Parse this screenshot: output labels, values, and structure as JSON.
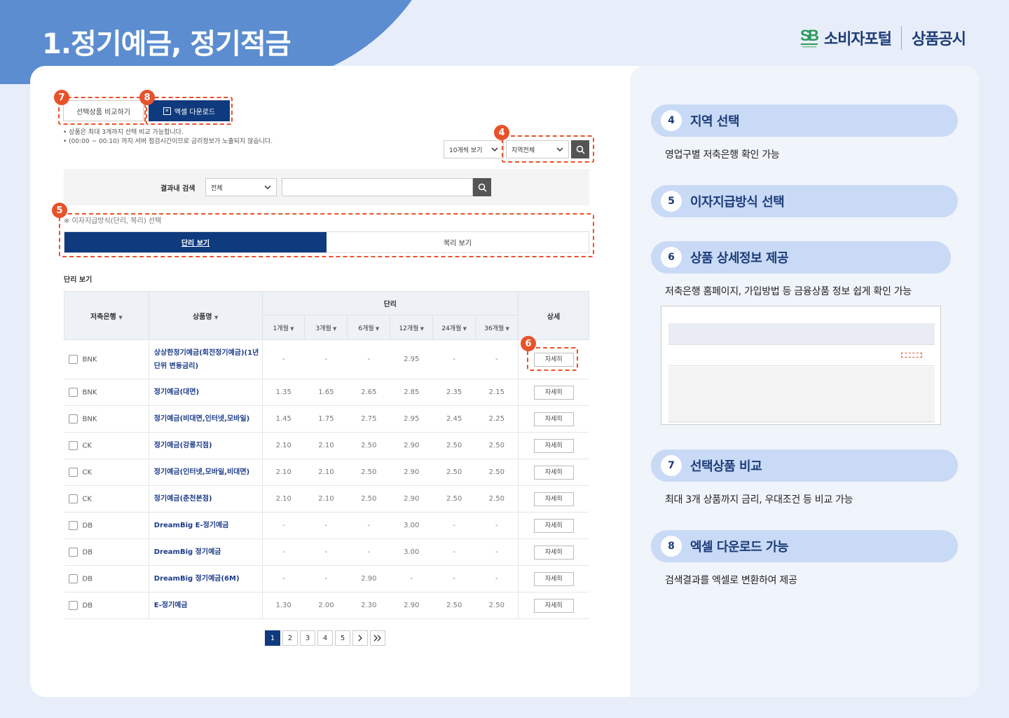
{
  "page": {
    "title": "1.정기예금, 정기적금"
  },
  "brand": {
    "name": "소비자포털",
    "section": "상품공시"
  },
  "annotations": {
    "b7": "7",
    "b8": "8",
    "b4": "4",
    "b5": "5",
    "b6": "6"
  },
  "toolbar": {
    "compare_label": "선택상품 비교하기",
    "excel_label": "엑셀 다운로드",
    "note1": "• 상품은 최대 3개까지 선택 비교 가능합니다.",
    "note2": "• (00:00 ~ 00:10) 까지 서버 점검시간이므로 금리정보가 노출되지 않습니다.",
    "page_size": "10개씩 보기",
    "region": "지역전체"
  },
  "result_search": {
    "label": "결과내 검색",
    "scope": "전체"
  },
  "interest_type": {
    "note": "※ 이자지급방식(단리, 복리) 선택",
    "simple": "단리 보기",
    "compound": "복리 보기"
  },
  "table": {
    "section_label": "단리 보기",
    "headers": {
      "bank": "저축은행",
      "product": "상품명",
      "rate_group": "단리",
      "detail": "상세"
    },
    "terms": [
      "1개월",
      "3개월",
      "6개월",
      "12개월",
      "24개월",
      "36개월"
    ],
    "detail_label": "자세히",
    "rows": [
      {
        "bank": "BNK",
        "name": "상상한정기예금(회전정기예금)(1년단위 변동금리)",
        "rates": [
          "-",
          "-",
          "-",
          "2.95",
          "-",
          "-"
        ]
      },
      {
        "bank": "BNK",
        "name": "정기예금(대면)",
        "rates": [
          "1.35",
          "1.65",
          "2.65",
          "2.85",
          "2.35",
          "2.15"
        ]
      },
      {
        "bank": "BNK",
        "name": "정기예금(비대면,인터넷,모바일)",
        "rates": [
          "1.45",
          "1.75",
          "2.75",
          "2.95",
          "2.45",
          "2.25"
        ]
      },
      {
        "bank": "CK",
        "name": "정기예금(강릉지점)",
        "rates": [
          "2.10",
          "2.10",
          "2.50",
          "2.90",
          "2.50",
          "2.50"
        ]
      },
      {
        "bank": "CK",
        "name": "정기예금(인터넷,모바일,비대면)",
        "rates": [
          "2.10",
          "2.10",
          "2.50",
          "2.90",
          "2.50",
          "2.50"
        ]
      },
      {
        "bank": "CK",
        "name": "정기예금(춘천본점)",
        "rates": [
          "2.10",
          "2.10",
          "2.50",
          "2.90",
          "2.50",
          "2.50"
        ]
      },
      {
        "bank": "DB",
        "name": "DreamBig E-정기예금",
        "rates": [
          "-",
          "-",
          "-",
          "3.00",
          "-",
          "-"
        ]
      },
      {
        "bank": "DB",
        "name": "DreamBig 정기예금",
        "rates": [
          "-",
          "-",
          "-",
          "3.00",
          "-",
          "-"
        ]
      },
      {
        "bank": "DB",
        "name": "DreamBig 정기예금(6M)",
        "rates": [
          "-",
          "-",
          "2.90",
          "-",
          "-",
          "-"
        ]
      },
      {
        "bank": "DB",
        "name": "E-정기예금",
        "rates": [
          "1.30",
          "2.00",
          "2.30",
          "2.90",
          "2.50",
          "2.50"
        ]
      }
    ]
  },
  "pagination": {
    "pages": [
      "1",
      "2",
      "3",
      "4",
      "5"
    ],
    "current": "1"
  },
  "features": [
    {
      "num": "4",
      "title": "지역 선택",
      "desc": "영업구별 저축은행 확인 가능"
    },
    {
      "num": "5",
      "title": "이자지급방식 선택",
      "desc": ""
    },
    {
      "num": "6",
      "title": "상품 상세정보 제공",
      "desc": "저축은행 홈페이지, 가입방법 등 금융상품 정보 쉽게 확인 가능"
    },
    {
      "num": "7",
      "title": "선택상품 비교",
      "desc": "최대 3개 상품까지 금리, 우대조건 등 비교 가능"
    },
    {
      "num": "8",
      "title": "엑셀 다운로드 가능",
      "desc": "검색결과를 엑셀로 변환하여 제공"
    }
  ],
  "colors": {
    "accent": "#0f3a7d",
    "marker": "#e8522b",
    "pill": "#c9daf6",
    "header_bg": "#5b8dd0"
  }
}
